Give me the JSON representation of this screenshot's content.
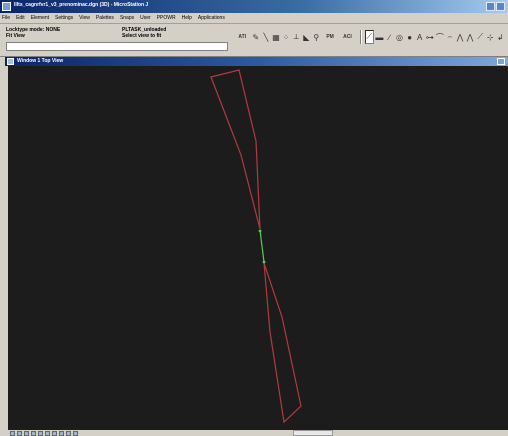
{
  "window": {
    "title": "lllts_cagnrfvr1_v3_prenominac.dgn (3D) - MicroStation J"
  },
  "menu": {
    "items": [
      "File",
      "Edit",
      "Element",
      "Settings",
      "View",
      "Palettes",
      "Snaps",
      "User",
      "PPOWR",
      "Help",
      "Applications"
    ]
  },
  "status": {
    "locks_line1": "Locktype mode: NONE",
    "locks_line2": "Fit View",
    "prompt_line1": "PLTASK_unloaded",
    "prompt_line2": "Select view to fit"
  },
  "toolbar": {
    "text_tool_1": "ATI",
    "text_tool_2": "PM",
    "text_tool_3": "ACI"
  },
  "view": {
    "title": "Window 1 Top View",
    "element_color": "#b23a3f",
    "highlight_color": "#4fd24f"
  }
}
